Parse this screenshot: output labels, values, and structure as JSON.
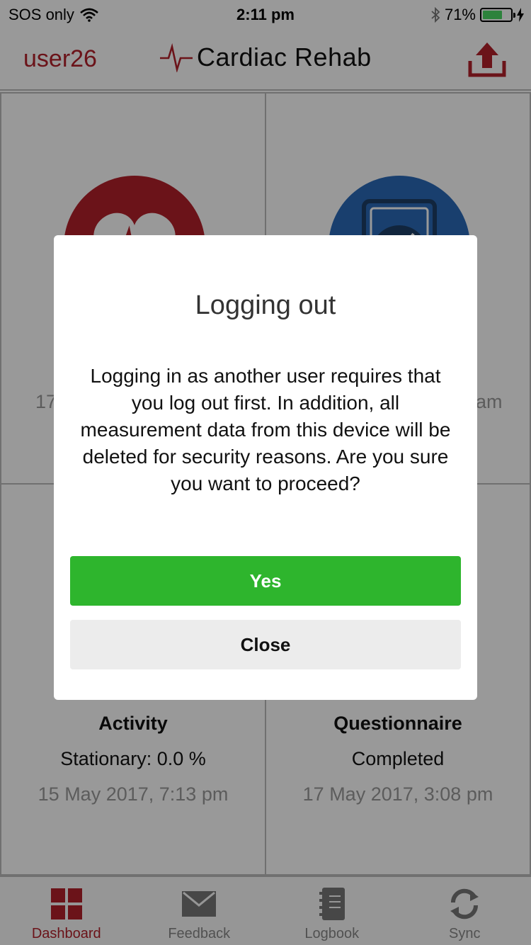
{
  "status_bar": {
    "carrier": "SOS only",
    "time": "2:11 pm",
    "battery_percent": "71%",
    "battery_level": 0.71,
    "icons": [
      "wifi-icon",
      "bluetooth-icon",
      "battery-icon",
      "charging-icon"
    ]
  },
  "header": {
    "user": "user26",
    "title": "Cardiac Rehab",
    "icons": [
      "heartbeat-icon",
      "upload-icon"
    ]
  },
  "tiles": {
    "heart": {
      "date_partial": "17",
      "icon": "heart-icon",
      "color": "#b3202b"
    },
    "blood_pressure": {
      "date_partial": "am",
      "icon": "blood-pressure-gauge-icon",
      "color": "#2a6ab8"
    },
    "activity": {
      "title": "Activity",
      "value": "Stationary: 0.0 %",
      "date": "15 May 2017, 7:13 pm"
    },
    "questionnaire": {
      "title": "Questionnaire",
      "value": "Completed",
      "date": "17 May 2017, 3:08 pm"
    }
  },
  "tabbar": {
    "tabs": [
      {
        "label": "Dashboard",
        "icon": "dashboard-grid-icon",
        "active": true
      },
      {
        "label": "Feedback",
        "icon": "envelope-icon",
        "active": false
      },
      {
        "label": "Logbook",
        "icon": "notebook-icon",
        "active": false
      },
      {
        "label": "Sync",
        "icon": "sync-icon",
        "active": false
      }
    ]
  },
  "modal": {
    "title": "Logging out",
    "message": "Logging in as another user requires that you log out first. In addition, all measurement data from this device will be deleted for security reasons. Are you sure you want to proceed?",
    "yes_label": "Yes",
    "close_label": "Close"
  },
  "colors": {
    "accent_red": "#b3202b",
    "confirm_green": "#2eb52d",
    "blood_pressure_blue": "#2a6ab8"
  }
}
